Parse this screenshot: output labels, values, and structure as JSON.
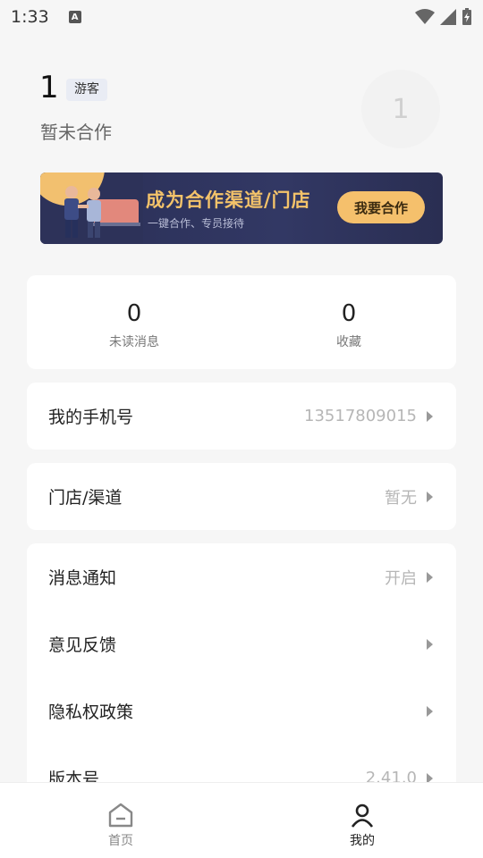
{
  "status_bar": {
    "time": "1:33",
    "indicator_letter": "A"
  },
  "profile": {
    "user_id": "1",
    "tag": "游客",
    "cooperation_status": "暂未合作",
    "avatar_text": "1"
  },
  "banner": {
    "title": "成为合作渠道/门店",
    "subtitle": "一键合作、专员接待",
    "button_label": "我要合作"
  },
  "stats": [
    {
      "value": "0",
      "label": "未读消息"
    },
    {
      "value": "0",
      "label": "收藏"
    }
  ],
  "phone": {
    "label": "我的手机号",
    "value": "13517809015"
  },
  "store": {
    "label": "门店/渠道",
    "value": "暂无"
  },
  "settings": [
    {
      "label": "消息通知",
      "value": "开启"
    },
    {
      "label": "意见反馈",
      "value": ""
    },
    {
      "label": "隐私权政策",
      "value": ""
    },
    {
      "label": "版本号",
      "value": "2.41.0"
    }
  ],
  "tabbar": {
    "home_label": "首页",
    "mine_label": "我的"
  },
  "colors": {
    "banner_bg": "#2a2f56",
    "banner_accent": "#f5c06c",
    "page_bg": "#f6f6f6"
  }
}
